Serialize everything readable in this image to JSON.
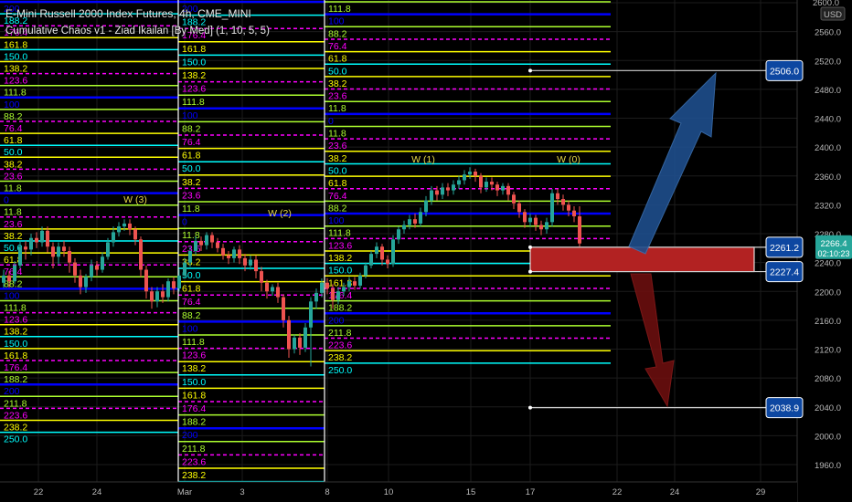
{
  "header": {
    "symbol_line": "E-Mini Russell 2000 Index Futures, 4h, CME_MINI",
    "indicator_line": "Cumulative Chaos v1 - Ziad Ikailan [By Med] (1, 10, 5, 5)"
  },
  "chart_data": {
    "type": "candlestick",
    "currency": "USD",
    "y_range": [
      1950,
      2600
    ],
    "y_ticks": [
      1960.0,
      2000.0,
      2040.0,
      2080.0,
      2120.0,
      2160.0,
      2200.0,
      2240.0,
      2280.0,
      2320.0,
      2360.0,
      2400.0,
      2440.0,
      2480.0,
      2520.0,
      2560.0,
      2600.0
    ],
    "x_labels": [
      "22",
      "24",
      "Mar",
      "3",
      "8",
      "10",
      "15",
      "17",
      "22",
      "24",
      "29"
    ],
    "current_price": "2266.4",
    "countdown": "02:10:23",
    "price_tags": [
      {
        "value": 2506.0,
        "label": "2506.0"
      },
      {
        "value": 2261.2,
        "label": "2261.2"
      },
      {
        "value": 2227.4,
        "label": "2227.4"
      },
      {
        "value": 2038.9,
        "label": "2038.9"
      }
    ],
    "wave_labels": [
      "W (3)",
      "W (2)",
      "W (1)",
      "W (0)"
    ],
    "zone": {
      "top": 2261.2,
      "bottom": 2227.4
    },
    "fib_levels": [
      {
        "label": "250.0",
        "color": "#ffffff"
      },
      {
        "label": "238.2",
        "color": "#ffff00"
      },
      {
        "label": "223.6",
        "color": "#ff00ff"
      },
      {
        "label": "211.8",
        "color": "#adff2f"
      },
      {
        "label": "200",
        "color": "#0000ff"
      },
      {
        "label": "188.2",
        "color": "#00ffff"
      },
      {
        "label": "176.4",
        "color": "#ff00ff"
      },
      {
        "label": "161.8",
        "color": "#ffff00"
      },
      {
        "label": "150.0",
        "color": "#00ffff"
      },
      {
        "label": "138.2",
        "color": "#ffff00"
      },
      {
        "label": "123.6",
        "color": "#ff00ff"
      },
      {
        "label": "111.8",
        "color": "#adff2f"
      },
      {
        "label": "100",
        "color": "#0000ff"
      },
      {
        "label": "88.2",
        "color": "#adff2f"
      },
      {
        "label": "76.4",
        "color": "#ff00ff"
      },
      {
        "label": "61.8",
        "color": "#ffff00"
      },
      {
        "label": "50.0",
        "color": "#00ffff"
      },
      {
        "label": "38.2",
        "color": "#ffff00"
      },
      {
        "label": "23.6",
        "color": "#ff00ff"
      },
      {
        "label": "11.8",
        "color": "#adff2f"
      },
      {
        "label": "0",
        "color": "#0000ff"
      },
      {
        "label": "-11.8",
        "color": "#adff2f"
      },
      {
        "label": "-23.6",
        "color": "#ff00ff"
      },
      {
        "label": "-38.2",
        "color": "#ffff00"
      },
      {
        "label": "-50.0",
        "color": "#00ffff"
      },
      {
        "label": "-61.8",
        "color": "#ffff00"
      },
      {
        "label": "-76.4",
        "color": "#ff00ff"
      },
      {
        "label": "-88.2",
        "color": "#adff2f"
      },
      {
        "label": "-100",
        "color": "#0000ff"
      },
      {
        "label": "-111.8",
        "color": "#adff2f"
      },
      {
        "label": "-123.6",
        "color": "#ff00ff"
      },
      {
        "label": "-138.2",
        "color": "#ffff00"
      },
      {
        "label": "-150.0",
        "color": "#00ffff"
      },
      {
        "label": "-161.8",
        "color": "#ffff00"
      },
      {
        "label": "-176.4",
        "color": "#ff00ff"
      },
      {
        "label": "-188.2",
        "color": "#adff2f"
      },
      {
        "label": "-200",
        "color": "#0000ff"
      },
      {
        "label": "-211.8",
        "color": "#adff2f"
      },
      {
        "label": "-223.6",
        "color": "#ff00ff"
      },
      {
        "label": "-238.2",
        "color": "#ffff00"
      },
      {
        "label": "-250.0",
        "color": "#00ffff"
      }
    ],
    "colors": {
      "up": "#26a69a",
      "down": "#ef5350",
      "zone": "#b22222",
      "arrow_up": "#1f4e8c",
      "arrow_down": "#6b0f0f",
      "tag_bg": "#0d47a1",
      "price_bg": "#26a69a",
      "grid": "#1c1c1c"
    }
  }
}
